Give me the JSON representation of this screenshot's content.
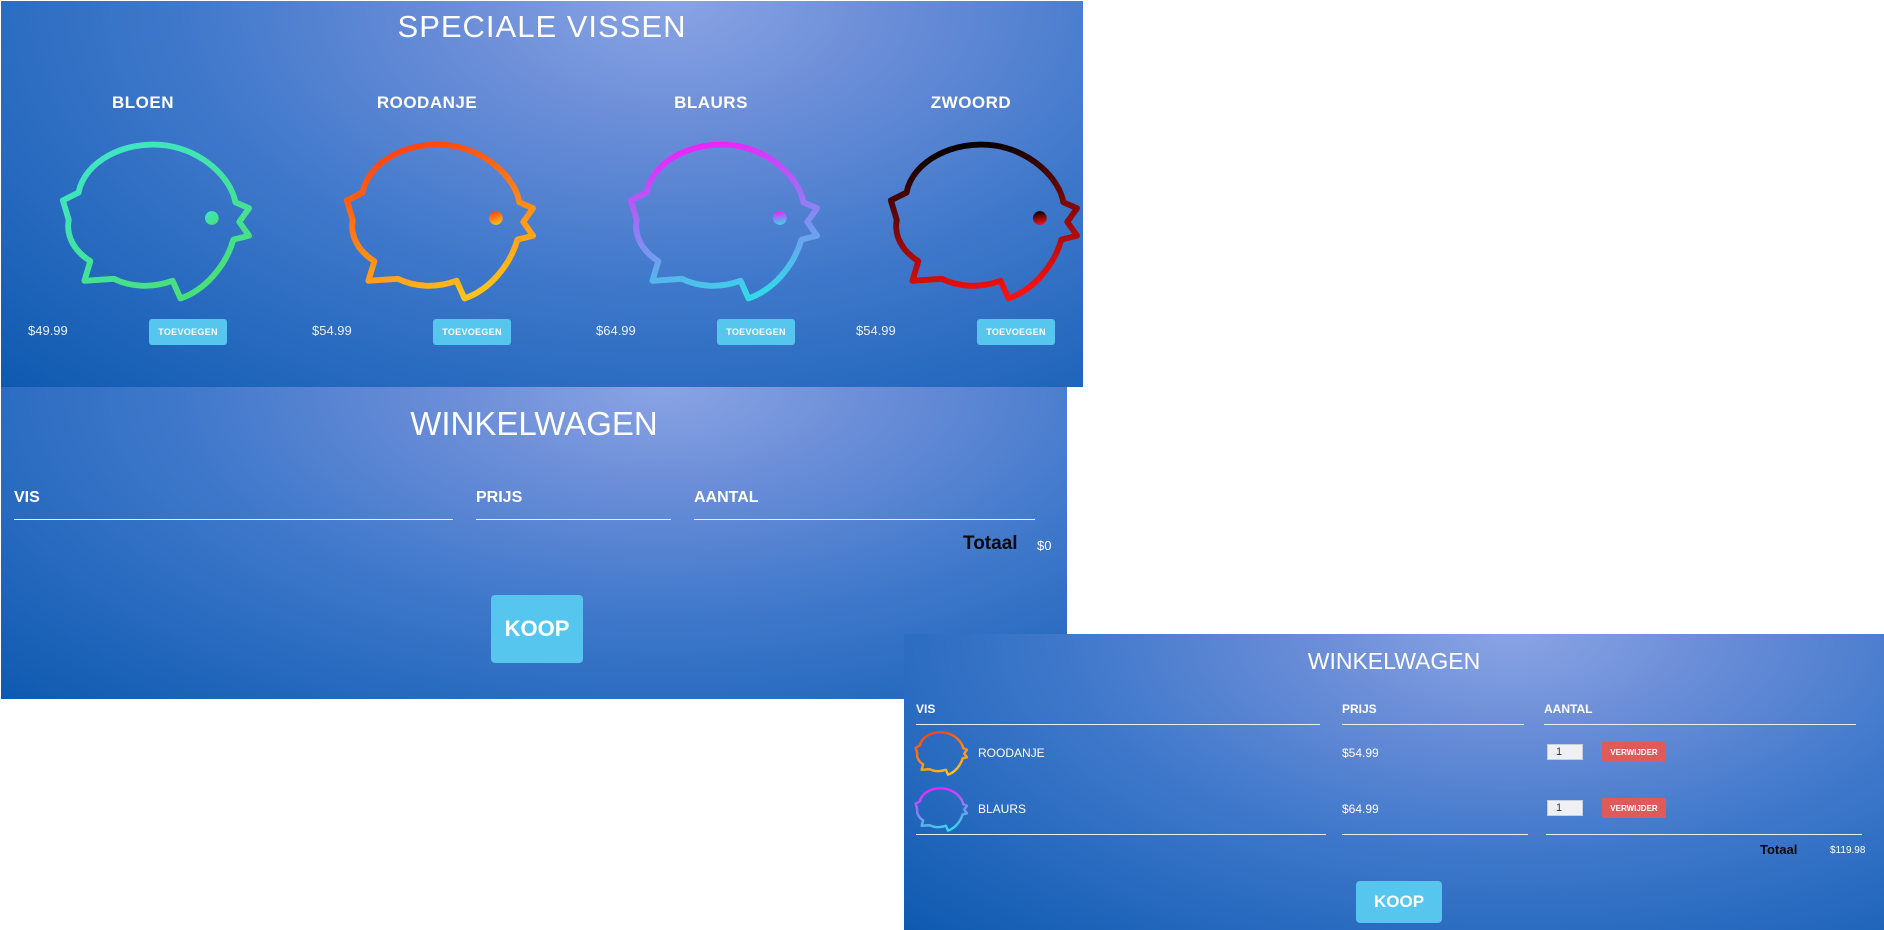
{
  "shop": {
    "title": "SPECIALE VISSEN",
    "products": [
      {
        "name": "BLOEN",
        "price": "$49.99",
        "button": "TOEVOEGEN",
        "icon": "fish-icon",
        "colors": [
          "#3ee6d0",
          "#47e07a"
        ]
      },
      {
        "name": "ROODANJE",
        "price": "$54.99",
        "button": "TOEVOEGEN",
        "icon": "fish-icon",
        "colors": [
          "#ff3d10",
          "#ffc21a"
        ]
      },
      {
        "name": "BLAURS",
        "price": "$64.99",
        "button": "TOEVOEGEN",
        "icon": "fish-icon",
        "colors": [
          "#f020ff",
          "#35d8e8"
        ]
      },
      {
        "name": "ZWOORD",
        "price": "$54.99",
        "button": "TOEVOEGEN",
        "icon": "fish-icon",
        "colors": [
          "#000000",
          "#ff1010"
        ]
      }
    ]
  },
  "cart_main": {
    "title": "WINKELWAGEN",
    "columns": {
      "fish": "VIS",
      "price": "PRIJS",
      "qty": "AANTAL"
    },
    "total_label": "Totaal",
    "total_value": "$0",
    "buy_label": "KOOP"
  },
  "cart_filled": {
    "title": "WINKELWAGEN",
    "columns": {
      "fish": "VIS",
      "price": "PRIJS",
      "qty": "AANTAL"
    },
    "rows": [
      {
        "name": "ROODANJE",
        "price": "$54.99",
        "qty": "1",
        "remove": "VERWIJDER"
      },
      {
        "name": "BLAURS",
        "price": "$64.99",
        "qty": "1",
        "remove": "VERWIJDER"
      }
    ],
    "total_label": "Totaal",
    "total_value": "$119.98",
    "buy_label": "KOOP"
  },
  "colors": {
    "accent_button": "#56c6ee",
    "remove_button": "#e05a5a"
  }
}
